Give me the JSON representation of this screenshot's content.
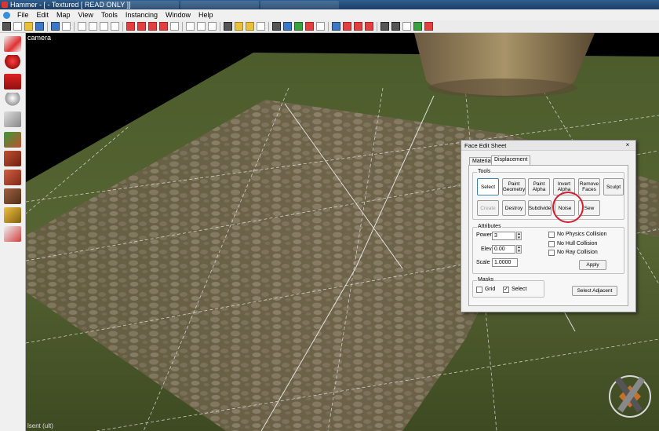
{
  "window": {
    "title": "Hammer - [ - Textured [ READ ONLY ]]"
  },
  "menu": [
    "File",
    "Edit",
    "Map",
    "View",
    "Tools",
    "Instancing",
    "Window",
    "Help"
  ],
  "viewport": {
    "camera_label": "camera",
    "bottom_label": "lsent (ult)"
  },
  "dialog": {
    "title": "Face Edit Sheet",
    "close_icon": "×",
    "tabs": [
      "Material",
      "Displacement"
    ],
    "active_tab": "Displacement",
    "tools": {
      "label": "Tools",
      "row1": [
        "Select",
        "Paint\nGeometry",
        "Paint\nAlpha",
        "Invert\nAlpha",
        "Remove\nFaces",
        "Sculpt"
      ],
      "row2": [
        "Create",
        "Destroy",
        "Subdivide",
        "Noise",
        "Sew"
      ]
    },
    "attributes": {
      "label": "Attributes",
      "power_label": "Power",
      "power_value": "3",
      "elev_label": "Elev",
      "elev_value": "0.00",
      "scale_label": "Scale",
      "scale_value": "1.0000",
      "checks": [
        "No Physics Collision",
        "No Hull Collision",
        "No Ray Collision"
      ],
      "apply_label": "Apply"
    },
    "masks": {
      "label": "Masks",
      "grid_label": "Grid",
      "grid_checked": false,
      "select_label": "Select",
      "select_checked": true,
      "select_adjacent_label": "Select Adjacent"
    }
  },
  "colors": {
    "highlight_circle": "#d21f2f",
    "grass": "#4a5a26",
    "cobble": "#8a7864"
  }
}
